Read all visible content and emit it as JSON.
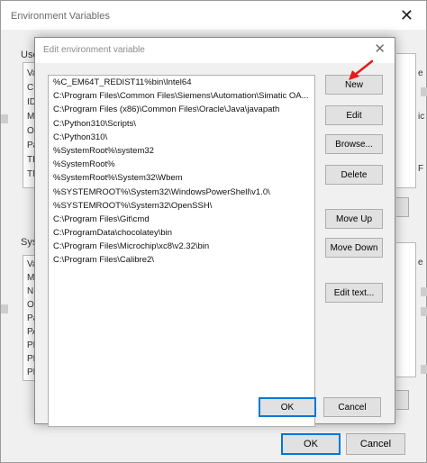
{
  "background_window": {
    "title": "Environment Variables",
    "user_group_label": "User",
    "system_group_label": "Syste",
    "user_list_items": [
      "Vai",
      "Chr",
      "IDI",
      "MO",
      "On",
      "Pat",
      "TEI",
      "TM"
    ],
    "system_list_items": [
      "Vai",
      "MO",
      "NU",
      "OS",
      "Pat",
      "PA",
      "PR",
      "PR",
      "PR"
    ],
    "right_cut_user": [
      "e",
      "ic",
      "F"
    ],
    "right_cut_system": [
      "e"
    ],
    "ok_label": "OK",
    "cancel_label": "Cancel"
  },
  "dialog": {
    "title": "Edit environment variable",
    "paths": [
      "%C_EM64T_REDIST11%bin\\Intel64",
      "C:\\Program Files\\Common Files\\Siemens\\Automation\\Simatic OA...",
      "C:\\Program Files (x86)\\Common Files\\Oracle\\Java\\javapath",
      "C:\\Python310\\Scripts\\",
      "C:\\Python310\\",
      "%SystemRoot%\\system32",
      "%SystemRoot%",
      "%SystemRoot%\\System32\\Wbem",
      "%SYSTEMROOT%\\System32\\WindowsPowerShell\\v1.0\\",
      "%SYSTEMROOT%\\System32\\OpenSSH\\",
      "C:\\Program Files\\Git\\cmd",
      "C:\\ProgramData\\chocolatey\\bin",
      "C:\\Program Files\\Microchip\\xc8\\v2.32\\bin",
      "C:\\Program Files\\Calibre2\\"
    ],
    "buttons": {
      "new": "New",
      "edit": "Edit",
      "browse": "Browse...",
      "delete": "Delete",
      "move_up": "Move Up",
      "move_down": "Move Down",
      "edit_text": "Edit text...",
      "ok": "OK",
      "cancel": "Cancel"
    }
  },
  "colors": {
    "accent": "#0078d7",
    "annotation_arrow": "#e21b1b"
  }
}
